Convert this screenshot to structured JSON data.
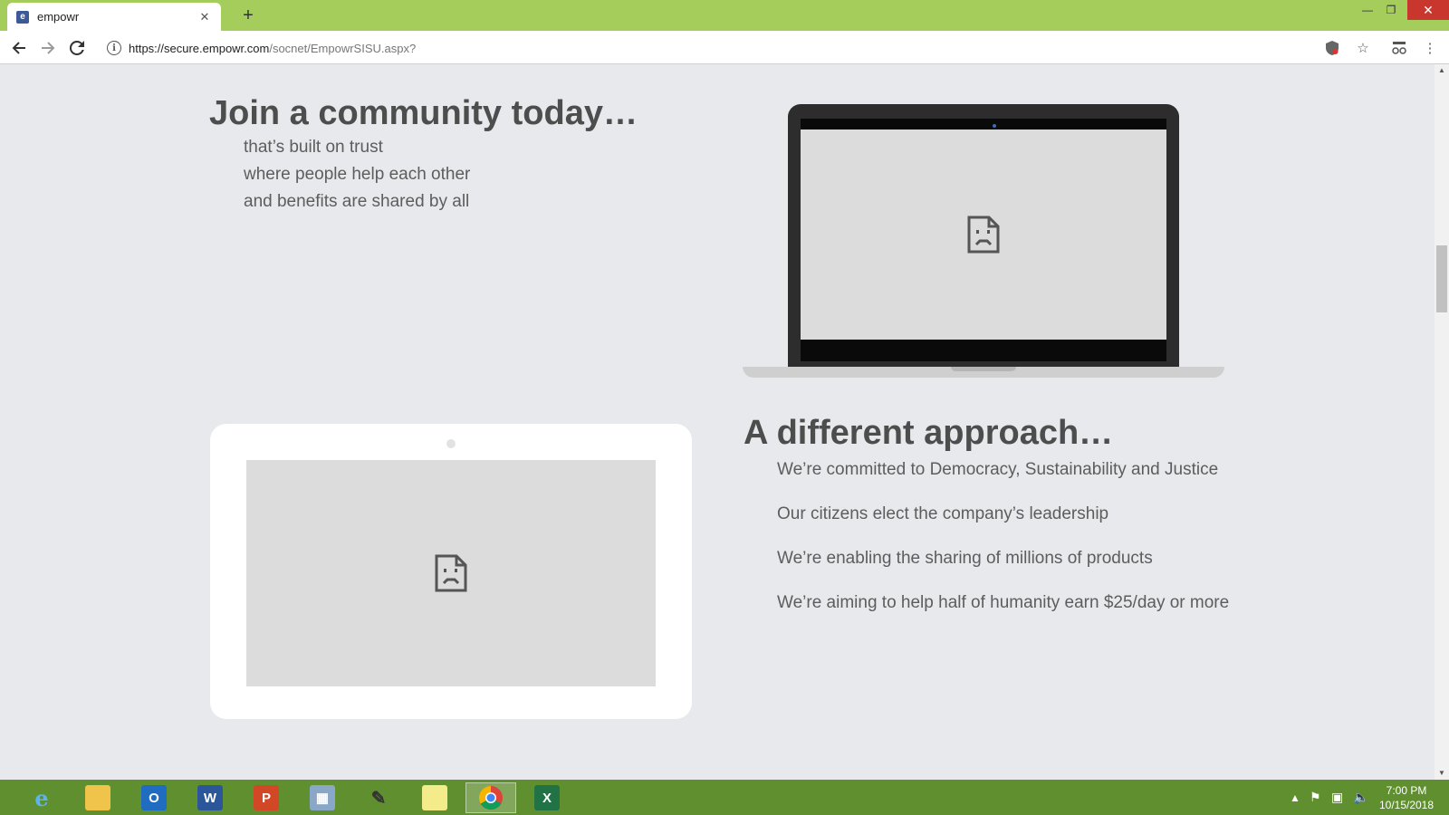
{
  "browser": {
    "tab_title": "empowr",
    "tab_favicon_letter": "e",
    "url_host": "https://secure.empowr.com",
    "url_path": "/socnet/EmpowrSISU.aspx?"
  },
  "page": {
    "section1": {
      "heading": "Join a community today…",
      "items": [
        "that’s built on trust",
        "where people help each other",
        "and benefits are shared by all"
      ]
    },
    "section2": {
      "heading": "A different approach…",
      "items": [
        "We’re committed to Democracy, Sustainability and Justice",
        "Our citizens elect the company’s leadership",
        "We’re enabling the sharing of millions of products",
        "We’re aiming to help half of humanity earn $25/day or more"
      ]
    }
  },
  "taskbar": {
    "time": "7:00 PM",
    "date": "10/15/2018",
    "apps": [
      "internet-explorer",
      "file-explorer",
      "outlook",
      "word",
      "powerpoint",
      "calculator",
      "pen-tool",
      "sticky-notes",
      "chrome",
      "excel"
    ]
  },
  "colors": {
    "titlebar": "#a5cd5c",
    "taskbar": "#5f8f2f",
    "page_bg": "#e8e9ec",
    "heading": "#4d4d4d"
  }
}
